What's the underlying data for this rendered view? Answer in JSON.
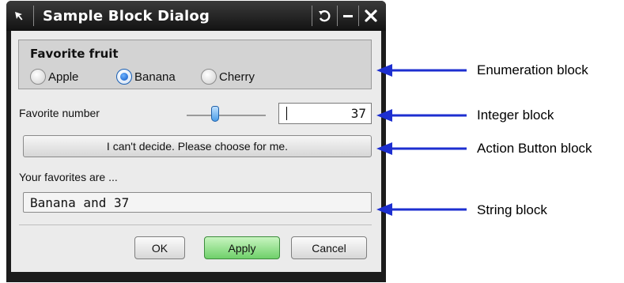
{
  "dialog": {
    "title": "Sample Block Dialog",
    "icons": {
      "pin": "pin-arrow-icon",
      "reset": "reset-icon",
      "minimize": "minimize-icon",
      "close": "close-icon"
    }
  },
  "enumeration": {
    "title": "Favorite fruit",
    "options": [
      "Apple",
      "Banana",
      "Cherry"
    ],
    "selected": "Banana"
  },
  "integer": {
    "label": "Favorite number",
    "value": "37"
  },
  "action_button": {
    "label": "I can't decide. Please choose for me."
  },
  "string": {
    "label": "Your favorites are ...",
    "value": "Banana and 37"
  },
  "footer": {
    "ok": "OK",
    "apply": "Apply",
    "cancel": "Cancel"
  },
  "annotations": [
    "Enumeration block",
    "Integer block",
    "Action Button block",
    "String block"
  ],
  "colors": {
    "arrow": "#1d2fd0",
    "selected_radio": "#0b55c4",
    "primary_button": "#6fd06a"
  }
}
